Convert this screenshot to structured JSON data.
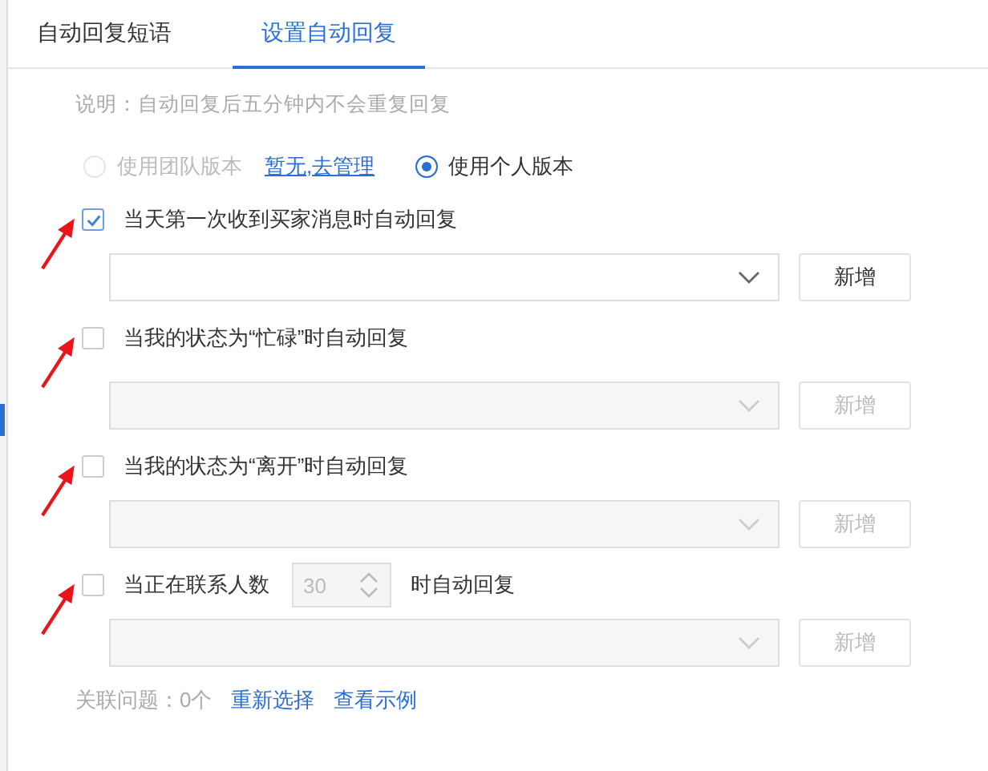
{
  "tabs": [
    {
      "label": "自动回复短语",
      "selected": false
    },
    {
      "label": "设置自动回复",
      "selected": true
    }
  ],
  "note": "说明：自动回复后五分钟内不会重复回复",
  "versions": [
    {
      "label": "使用团队版本",
      "selected": false,
      "disabled": true,
      "link": "暂无,去管理"
    },
    {
      "label": "使用个人版本",
      "selected": true,
      "disabled": false
    }
  ],
  "rules": [
    {
      "kind": "plain",
      "label": "当天第一次收到买家消息时自动回复",
      "checked": true,
      "button": "新增"
    },
    {
      "kind": "plain",
      "label": "当我的状态为“忙碌”时自动回复",
      "checked": false,
      "button": "新增"
    },
    {
      "kind": "plain",
      "label": "当我的状态为“离开”时自动回复",
      "checked": false,
      "button": "新增"
    },
    {
      "kind": "count",
      "label": "当正在联系人数",
      "count": "30",
      "suffix": "时自动回复",
      "checked": false,
      "button": "新增"
    }
  ],
  "footer": {
    "text": "关联问题：0个",
    "links": [
      "重新选择",
      "查看示例"
    ]
  }
}
